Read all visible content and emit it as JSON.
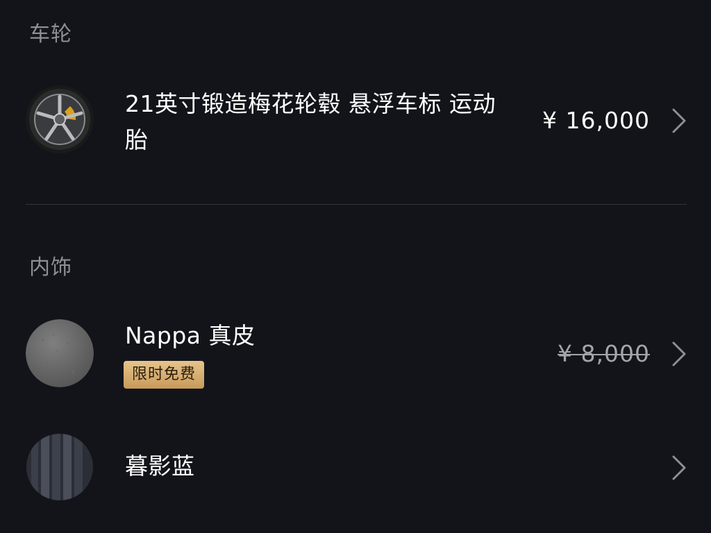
{
  "sections": {
    "wheels": {
      "title": "车轮",
      "item": {
        "name_line1": "21英寸锻造梅花轮毂 悬浮车标 运动",
        "name_line2": "胎",
        "price": "¥ 16,000",
        "thumbnail_icon": "alloy-wheel-icon"
      }
    },
    "interior": {
      "title": "内饰",
      "items": [
        {
          "name": "Nappa 真皮",
          "price": "¥ 8,000",
          "price_struck": true,
          "badge": "限时免费",
          "thumbnail_icon": "leather-swatch-icon"
        },
        {
          "name": "暮影蓝",
          "thumbnail_icon": "blue-trim-swatch-icon"
        }
      ]
    }
  },
  "colors": {
    "background": "#13141a",
    "section_title": "#8d8f96",
    "divider": "#34363d",
    "badge_gold": "#d8b074",
    "struck_price": "#a3a5ab"
  }
}
